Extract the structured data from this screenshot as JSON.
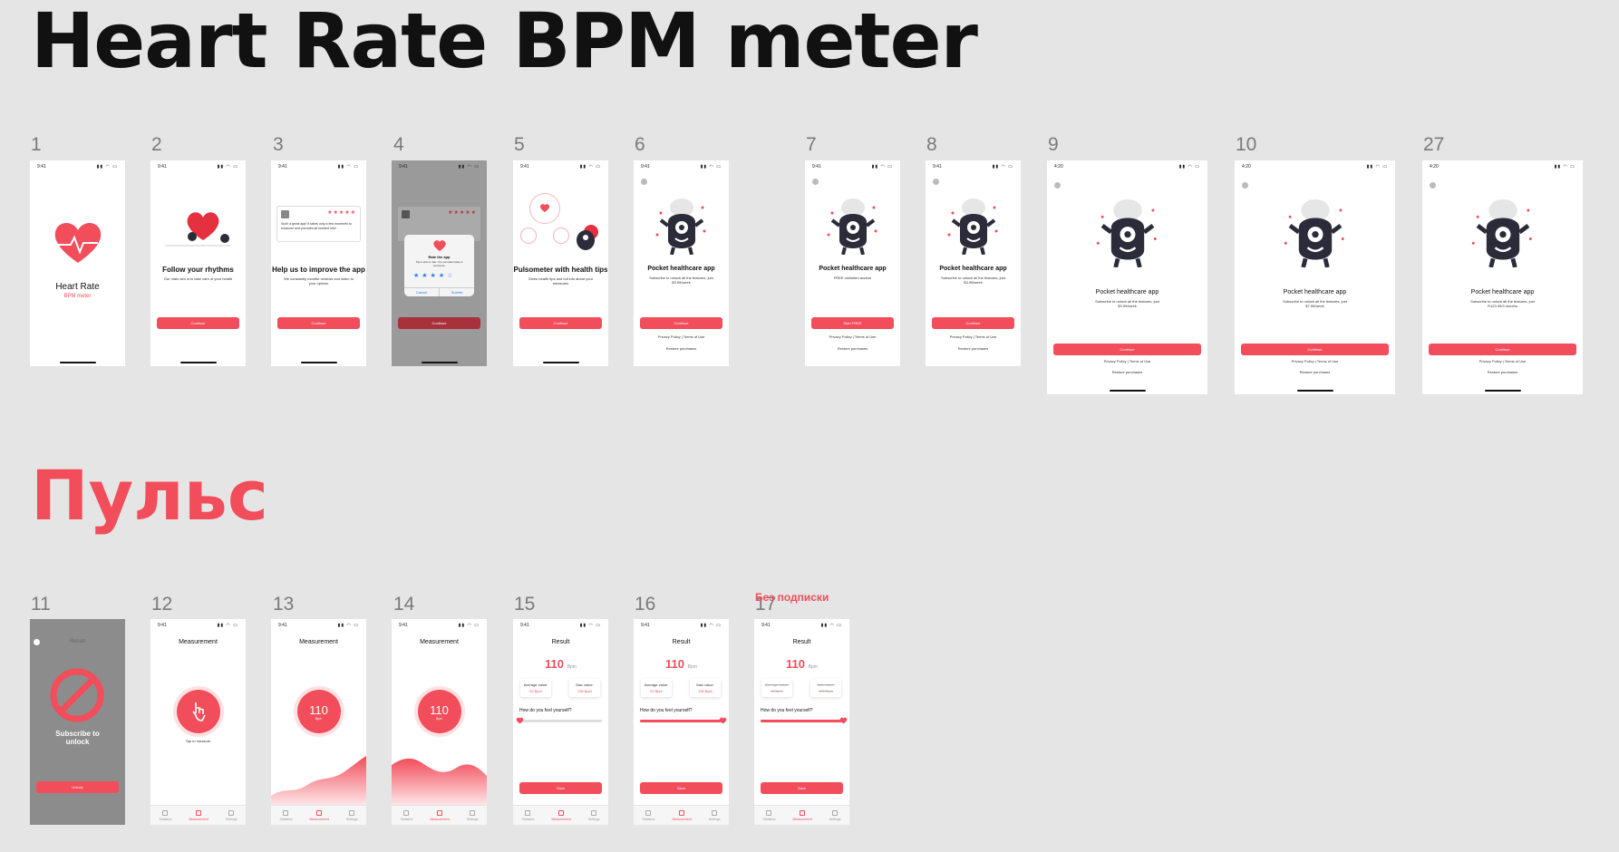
{
  "page": {
    "title": "Heart Rate BPM meter",
    "section2_title": "Пульс",
    "note": "Без подписки"
  },
  "status": {
    "time": "9:41",
    "time_wide": "4:20"
  },
  "row1": {
    "numbers": [
      "1",
      "2",
      "3",
      "4",
      "5",
      "6",
      "7",
      "8",
      "9",
      "10",
      "27"
    ],
    "s1": {
      "title": "Heart Rate",
      "subtitle": "BPM meter"
    },
    "s2": {
      "title": "Follow your rhythms",
      "text": "Our main aim is to take care of your health",
      "button": "Continue"
    },
    "s3": {
      "title": "Help us to improve the app",
      "text": "We constantly monitor reviews and listen to your opinion",
      "review": "Such a great app! It takes only a few moments to measure and provides all needed info!",
      "button": "Continue"
    },
    "s4": {
      "dialog_title": "Rate the app",
      "dialog_text": "Tap a star to rate. You can also leave a comment.",
      "cancel": "Cancel",
      "submit": "Submit",
      "button": "Continue"
    },
    "s5": {
      "title": "Pulsometer with health tips",
      "text": "Gives health tips and full info about your measures",
      "button": "Continue"
    },
    "s6": {
      "title": "Pocket healthcare app",
      "text": "Subscribe to unlock all the features, just $3.99/week",
      "button": "Continue",
      "links": "Privacy Policy | Terms of Use",
      "restore": "Restore purchases"
    },
    "s7": {
      "title": "Pocket healthcare app",
      "text": "FREE unlimited access",
      "button": "Start FREE",
      "links": "Privacy Policy | Terms of Use",
      "restore": "Restore purchases"
    },
    "s8": {
      "title": "Pocket healthcare app",
      "text": "Subscribe to unlock all the features, just $3.99/week",
      "button": "Continue",
      "links": "Privacy Policy | Terms of Use",
      "restore": "Restore purchases"
    },
    "s9": {
      "title": "Pocket healthcare app",
      "text": "Subscribe to unlock all the features, just $3.99/week",
      "button": "Continue",
      "links": "Privacy Policy | Terms of Use",
      "restore": "Restore purchases"
    },
    "s10": {
      "title": "Pocket healthcare app",
      "text": "Subscribe to unlock all the features, just $7.99/week",
      "button": "Continue",
      "links": "Privacy Policy | Terms of Use",
      "restore": "Restore purchases"
    },
    "s27": {
      "title": "Pocket healthcare app",
      "text": "Subscribe to unlock all the features, just R123.99/3 months",
      "button": "Continue",
      "links": "Privacy Policy | Terms of Use",
      "restore": "Restore purchases"
    }
  },
  "row2": {
    "numbers": [
      "11",
      "12",
      "13",
      "14",
      "15",
      "16",
      "17"
    ],
    "tabs": [
      "Statistics",
      "Measurement",
      "Settings"
    ],
    "s11": {
      "header": "Result",
      "lock": "Subscribe to unlock",
      "button": "Unlock"
    },
    "s12": {
      "header": "Measurement",
      "hint": "Tap to measure"
    },
    "s13": {
      "header": "Measurement",
      "value": "110",
      "unit": "Bpm"
    },
    "s14": {
      "header": "Measurement",
      "value": "110",
      "unit": "Bpm"
    },
    "result": {
      "header": "Result",
      "value": "110",
      "unit": "Bpm",
      "avg_label": "Average value:",
      "avg": "92 Bpm",
      "max_label": "Max value:",
      "max": "135 Bpm",
      "question": "How do you feel yourself?",
      "button": "Save"
    },
    "feel_levels": {
      "s15": 0.0,
      "s16": 1.0,
      "s17": 1.0
    }
  },
  "colors": {
    "accent": "#f24d5b",
    "background": "#e5e5e5"
  }
}
